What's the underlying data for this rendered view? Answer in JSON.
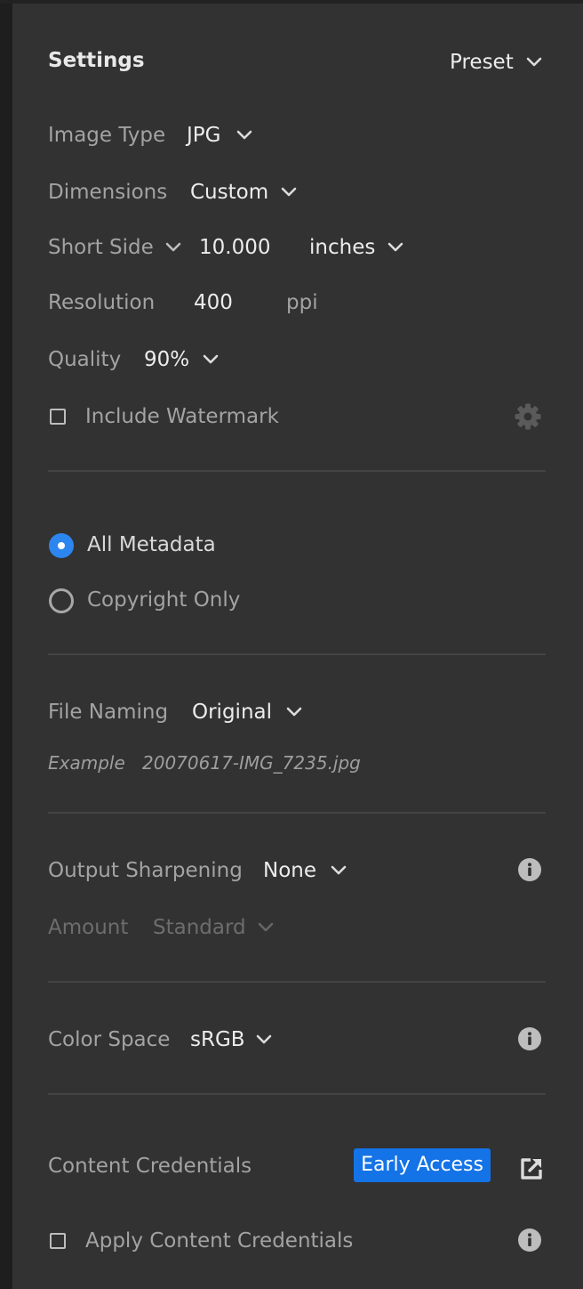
{
  "header": {
    "title": "Settings",
    "preset_label": "Preset"
  },
  "image_type": {
    "label": "Image Type",
    "value": "JPG"
  },
  "dimensions": {
    "label": "Dimensions",
    "value": "Custom"
  },
  "short_side": {
    "label": "Short Side",
    "value": "10.000",
    "unit": "inches"
  },
  "resolution": {
    "label": "Resolution",
    "value": "400",
    "unit": "ppi"
  },
  "quality": {
    "label": "Quality",
    "value": "90%"
  },
  "watermark": {
    "label": "Include Watermark",
    "checked": false
  },
  "metadata": {
    "options": [
      {
        "label": "All Metadata",
        "selected": true
      },
      {
        "label": "Copyright Only",
        "selected": false
      }
    ]
  },
  "file_naming": {
    "label": "File Naming",
    "value": "Original",
    "example_label": "Example",
    "example_value": "20070617-IMG_7235.jpg"
  },
  "output_sharpening": {
    "label": "Output Sharpening",
    "value": "None",
    "amount_label": "Amount",
    "amount_value": "Standard"
  },
  "color_space": {
    "label": "Color Space",
    "value": "sRGB"
  },
  "content_credentials": {
    "label": "Content Credentials",
    "badge": "Early Access",
    "apply_label": "Apply Content Credentials",
    "apply_checked": false
  },
  "colors": {
    "panel_bg": "#323232",
    "accent_blue": "#1473e6",
    "radio_blue": "#2d86f0",
    "label_gray": "#a3a3a3",
    "value_white": "#ececec",
    "disabled_gray": "#6d6d6d"
  },
  "icons": {
    "chevron": "chevron-down-icon",
    "gear": "gear-icon",
    "info": "info-icon",
    "external": "external-link-icon"
  }
}
